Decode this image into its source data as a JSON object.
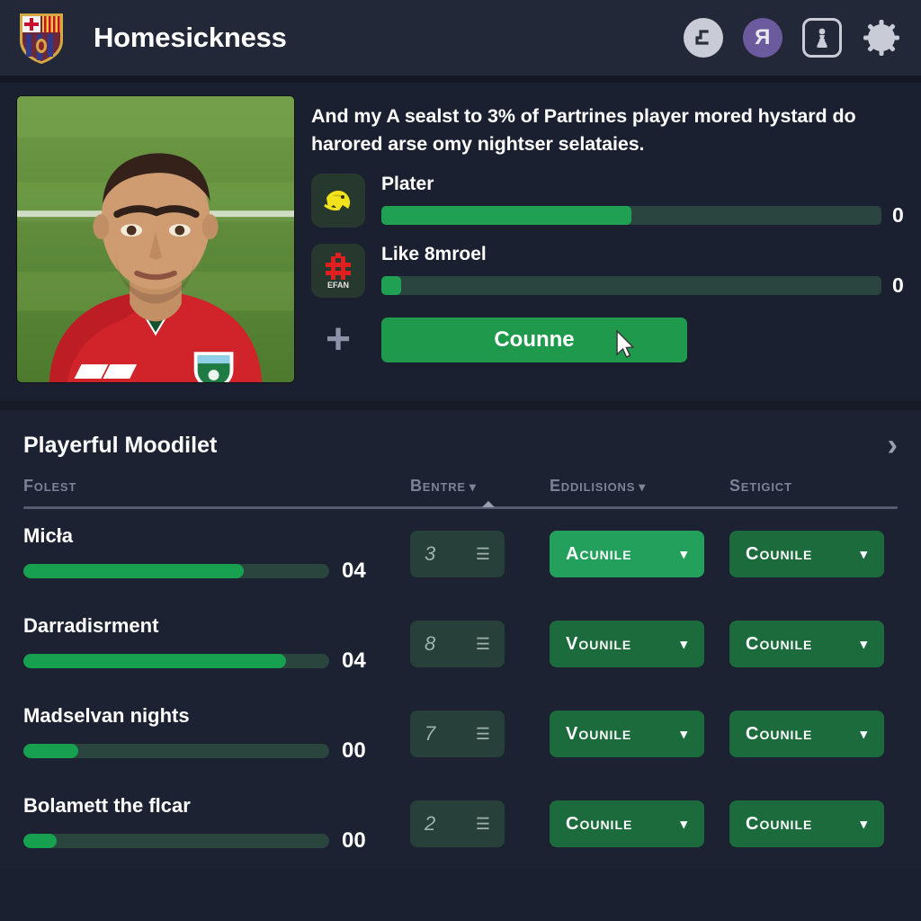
{
  "header": {
    "title": "Homesickness",
    "crest_name": "club-crest-logo",
    "icons": [
      {
        "name": "arrow-corner-icon",
        "glyph": "⌐",
        "style": "circle-light"
      },
      {
        "name": "reversed-r-icon",
        "glyph": "Я",
        "style": "circle-purple"
      },
      {
        "name": "pawn-frame-icon",
        "glyph": "♟",
        "style": "sq-outline"
      },
      {
        "name": "gear-icon",
        "glyph": "",
        "style": "gear"
      }
    ]
  },
  "profile": {
    "photo_alt": "player-portrait",
    "description": "And my A sealst to 3% of Partrines player mored hystard do harored arse omy nightser selataies.",
    "stats": [
      {
        "badge": "lion-crest-badge",
        "label": "Plater",
        "percent": 50,
        "value": "0"
      },
      {
        "badge": "efan-crest-badge",
        "label": "Like 8mroel",
        "percent": 4,
        "value": "0"
      }
    ],
    "add_icon": "plus-icon",
    "cta_label": "Counne",
    "cursor_icon": "mouse-cursor"
  },
  "section": {
    "title": "Playerful Moodilet",
    "expand_icon": "chevron-right-icon",
    "columns": [
      {
        "label": "Folest",
        "caret": false
      },
      {
        "label": "Bentre",
        "caret": true
      },
      {
        "label": "Eddilisions",
        "caret": true
      },
      {
        "label": "Setigict",
        "caret": false
      }
    ],
    "rows": [
      {
        "name": "Micła",
        "percent": 72,
        "value": "04",
        "stepper": "3",
        "option_b": "Acunile",
        "option_b_active": true,
        "option_c": "Counile"
      },
      {
        "name": "Darradisrment",
        "percent": 86,
        "value": "04",
        "stepper": "8",
        "option_b": "Vounile",
        "option_b_active": false,
        "option_c": "Counile"
      },
      {
        "name": "Madselvan nights",
        "percent": 18,
        "value": "00",
        "stepper": "7",
        "option_b": "Vounile",
        "option_b_active": false,
        "option_c": "Counile"
      },
      {
        "name": "Bolamett the flcar",
        "percent": 11,
        "value": "00",
        "stepper": "2",
        "option_b": "Counile",
        "option_b_active": false,
        "option_c": "Counile"
      }
    ]
  },
  "colors": {
    "page_bg": "#1b2030",
    "header_bg": "#232838",
    "accent_green": "#1fa052",
    "active_green": "#23a05c",
    "dd_green": "#1c6b3c",
    "track_green": "#2a4440"
  }
}
